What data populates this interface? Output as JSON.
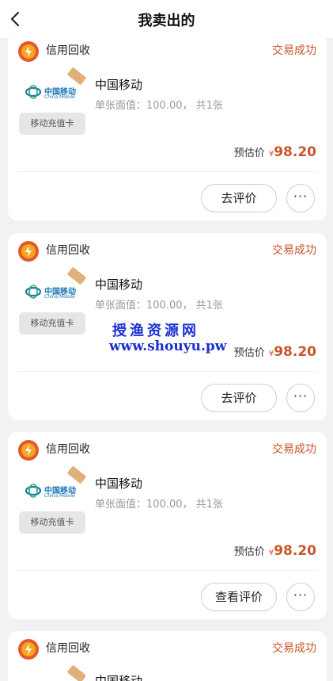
{
  "header": {
    "title": "我卖出的",
    "back_icon": "chevron-left-icon"
  },
  "orders": [
    {
      "merchant": "信用回收",
      "status": "交易成功",
      "product_name": "中国移动",
      "product_detail": "单张面值：100.00， 共1张",
      "card_badge": "移动充值卡",
      "price_label": "预估价",
      "currency": "¥",
      "price": "98.20",
      "action_label": "去评价"
    },
    {
      "merchant": "信用回收",
      "status": "交易成功",
      "product_name": "中国移动",
      "product_detail": "单张面值：100.00， 共1张",
      "card_badge": "移动充值卡",
      "price_label": "预估价",
      "currency": "¥",
      "price": "98.20",
      "action_label": "去评价"
    },
    {
      "merchant": "信用回收",
      "status": "交易成功",
      "product_name": "中国移动",
      "product_detail": "单张面值：100.00， 共1张",
      "card_badge": "移动充值卡",
      "price_label": "预估价",
      "currency": "¥",
      "price": "98.20",
      "action_label": "查看评价"
    },
    {
      "merchant": "信用回收",
      "status": "交易成功",
      "product_name": "中国移动"
    }
  ],
  "brand": {
    "logo_cn": "中国移动",
    "logo_en": "China Mobile"
  },
  "more_label": "···",
  "watermark": {
    "line1": "授渔资源网",
    "line2": "www.shouyu.pw"
  },
  "colors": {
    "accent": "#c9562a",
    "background": "#f2f2f2",
    "watermark": "#1a2fd0"
  }
}
